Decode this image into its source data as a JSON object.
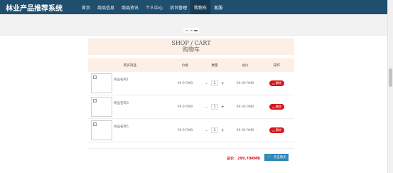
{
  "brand": "林业产品推荐系统",
  "nav": [
    {
      "label": "首页",
      "active": false
    },
    {
      "label": "商品信息",
      "active": false
    },
    {
      "label": "商品资讯",
      "active": false
    },
    {
      "label": "个人中心",
      "active": false
    },
    {
      "label": "后台管理",
      "active": false
    },
    {
      "label": "购物车",
      "active": true
    },
    {
      "label": "客服",
      "active": false
    }
  ],
  "carousel": {
    "active_dot": 2,
    "dot_count": 3
  },
  "cart": {
    "title_en": "SHOP / CART",
    "title_cn": "购物车",
    "headers": {
      "product": "购买商品",
      "price": "价格",
      "qty": "数量",
      "total": "总价",
      "action": "操作"
    },
    "items": [
      {
        "name": "商品名称1",
        "price": "99.9 RMB",
        "qty": "1",
        "total": "99.90 RMB",
        "delete": "删除"
      },
      {
        "name": "商品名称3",
        "price": "99.9 RMB",
        "qty": "1",
        "total": "99.90 RMB",
        "delete": "删除"
      },
      {
        "name": "商品名称5",
        "price": "99.9 RMB",
        "qty": "1",
        "total": "99.90 RMB",
        "delete": "删除"
      }
    ],
    "grand_total": "总价：299.70RMB",
    "checkout": "点击购买"
  },
  "colors": {
    "nav_bg": "#1f4e6e",
    "accent_red": "#d6171b",
    "checkout_blue": "#2f86b7",
    "header_bg": "#fcefe6"
  }
}
